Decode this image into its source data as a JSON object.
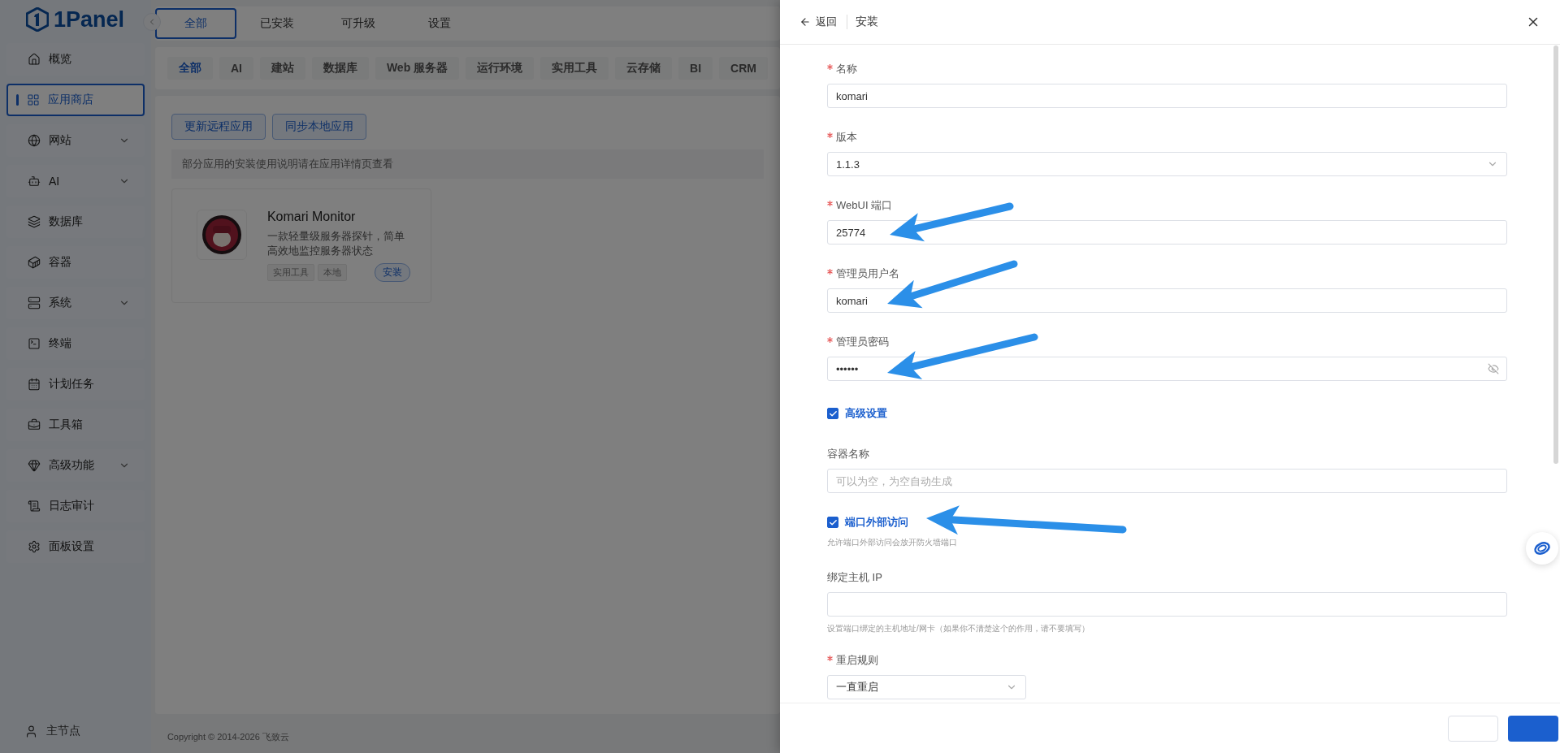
{
  "brand": {
    "name": "1Panel"
  },
  "sidebar": {
    "items": [
      {
        "label": "概览",
        "selected": false,
        "expandable": false
      },
      {
        "label": "应用商店",
        "selected": true,
        "expandable": false
      },
      {
        "label": "网站",
        "selected": false,
        "expandable": true
      },
      {
        "label": "AI",
        "selected": false,
        "expandable": true
      },
      {
        "label": "数据库",
        "selected": false,
        "expandable": false
      },
      {
        "label": "容器",
        "selected": false,
        "expandable": false
      },
      {
        "label": "系统",
        "selected": false,
        "expandable": true
      },
      {
        "label": "终端",
        "selected": false,
        "expandable": false
      },
      {
        "label": "计划任务",
        "selected": false,
        "expandable": false
      },
      {
        "label": "工具箱",
        "selected": false,
        "expandable": false
      },
      {
        "label": "高级功能",
        "selected": false,
        "expandable": true
      },
      {
        "label": "日志审计",
        "selected": false,
        "expandable": false
      },
      {
        "label": "面板设置",
        "selected": false,
        "expandable": false
      }
    ],
    "node": "主节点"
  },
  "top_tabs": [
    {
      "label": "全部",
      "selected": true
    },
    {
      "label": "已安装",
      "selected": false
    },
    {
      "label": "可升级",
      "selected": false
    },
    {
      "label": "设置",
      "selected": false
    }
  ],
  "categories": [
    {
      "label": "全部",
      "selected": true
    },
    {
      "label": "AI",
      "selected": false
    },
    {
      "label": "建站",
      "selected": false
    },
    {
      "label": "数据库",
      "selected": false
    },
    {
      "label": "Web 服务器",
      "selected": false
    },
    {
      "label": "运行环境",
      "selected": false
    },
    {
      "label": "实用工具",
      "selected": false
    },
    {
      "label": "云存储",
      "selected": false
    },
    {
      "label": "BI",
      "selected": false
    },
    {
      "label": "CRM",
      "selected": false
    }
  ],
  "actions": [
    "更新远程应用",
    "同步本地应用"
  ],
  "notice": "部分应用的安装使用说明请在应用详情页查看",
  "apps": [
    {
      "name": "Komari Monitor",
      "description": "一款轻量级服务器探针，简单高效地监控服务器状态",
      "tags": [
        "实用工具",
        "本地"
      ],
      "install": "安装"
    }
  ],
  "footer": "Copyright © 2014-2026 飞致云",
  "drawer": {
    "back": "返回",
    "title": "安装",
    "fields": [
      {
        "kind": "text",
        "label": "名称",
        "required": true,
        "value": "komari"
      },
      {
        "kind": "select",
        "label": "版本",
        "required": true,
        "value": "1.1.3"
      },
      {
        "kind": "text",
        "label": "WebUI 端口",
        "required": true,
        "value": "25774"
      },
      {
        "kind": "text",
        "label": "管理员用户名",
        "required": true,
        "value": "komari"
      },
      {
        "kind": "password",
        "label": "管理员密码",
        "required": true,
        "value": "••••••"
      },
      {
        "kind": "checkbox",
        "label": "高级设置",
        "checked": true
      },
      {
        "kind": "text",
        "label": "容器名称",
        "required": false,
        "placeholder": "可以为空，为空自动生成"
      },
      {
        "kind": "checkbox",
        "label": "端口外部访问",
        "checked": true,
        "help": "允许端口外部访问会放开防火墙端口"
      },
      {
        "kind": "text",
        "label": "绑定主机 IP",
        "required": false,
        "help": "设置端口绑定的主机地址/网卡（如果你不清楚这个的作用，请不要填写）"
      },
      {
        "kind": "short-select",
        "label": "重启规则",
        "required": true,
        "value": "一直重启"
      }
    ]
  }
}
